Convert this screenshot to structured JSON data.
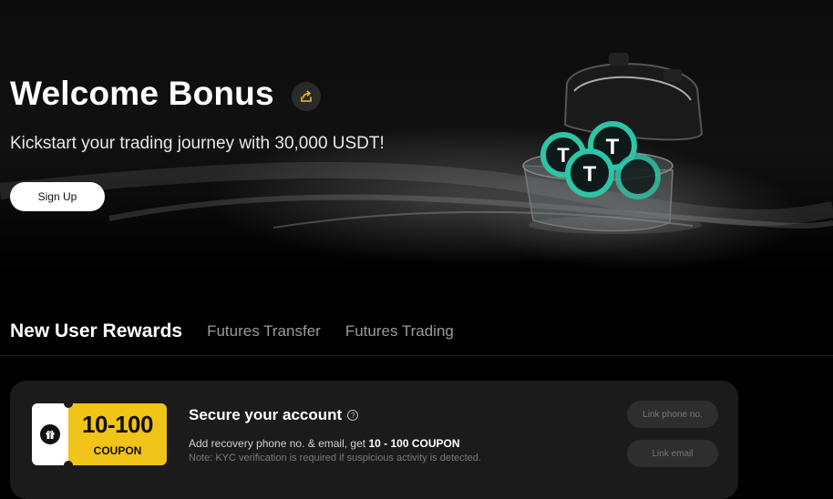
{
  "hero": {
    "title": "Welcome Bonus",
    "subtitle": "Kickstart your trading journey with 30,000 USDT!",
    "signup_label": "Sign Up"
  },
  "tabs": [
    {
      "label": "New User Rewards",
      "active": true
    },
    {
      "label": "Futures Transfer",
      "active": false
    },
    {
      "label": "Futures Trading",
      "active": false
    }
  ],
  "task": {
    "coupon_amount": "10-100",
    "coupon_label": "COUPON",
    "title": "Secure your account",
    "desc_prefix": "Add recovery phone no. & email, get",
    "desc_highlight": "10 - 100 COUPON",
    "note": "Note: KYC verification is required if suspicious activity is detected.",
    "phone_button": "Link phone no.",
    "email_button": "Link email"
  },
  "colors": {
    "accent": "#f0c419",
    "background": "#000000",
    "card": "#1b1b1b"
  },
  "icons": {
    "share": "share-icon",
    "gift": "gift-icon",
    "help": "help-circle-icon"
  }
}
